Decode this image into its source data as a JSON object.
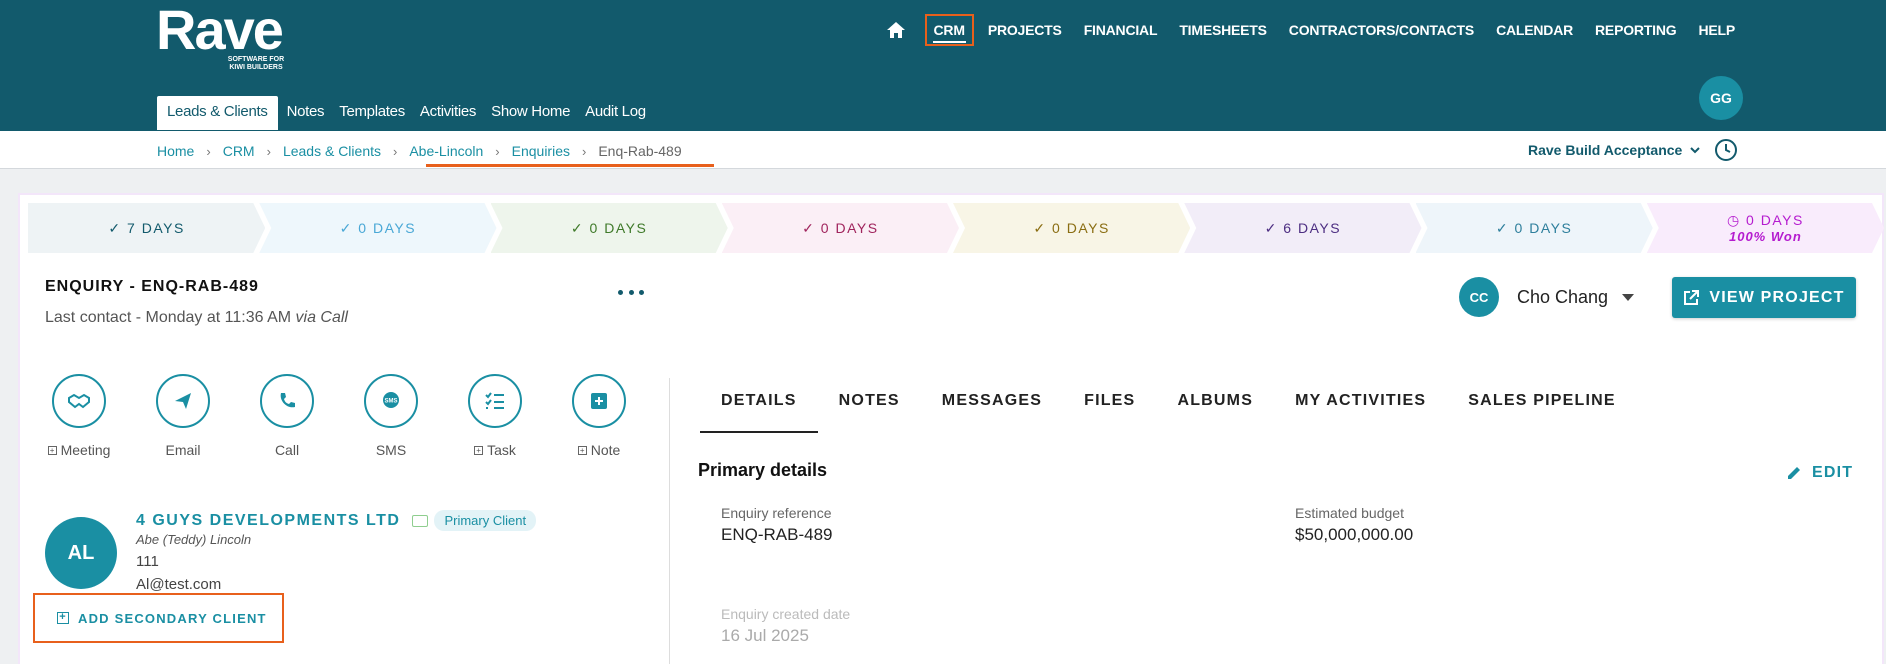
{
  "header": {
    "logo_word": "Rave",
    "logo_tagline": "SOFTWARE FOR KIWI BUILDERS",
    "nav": [
      "CRM",
      "PROJECTS",
      "FINANCIAL",
      "TIMESHEETS",
      "CONTRACTORS/CONTACTS",
      "CALENDAR",
      "REPORTING",
      "HELP"
    ],
    "user_initials": "GG",
    "subnav": [
      "Leads & Clients",
      "Notes",
      "Templates",
      "Activities",
      "Show Home",
      "Audit Log"
    ]
  },
  "breadcrumb": [
    "Home",
    "CRM",
    "Leads & Clients",
    "Abe-Lincoln",
    "Enquiries",
    "Enq-Rab-489"
  ],
  "build_selector": "Rave Build Acceptance",
  "stages": [
    {
      "label": "7 DAYS",
      "sub": ""
    },
    {
      "label": "0 DAYS",
      "sub": ""
    },
    {
      "label": "0 DAYS",
      "sub": ""
    },
    {
      "label": "0 DAYS",
      "sub": ""
    },
    {
      "label": "0 DAYS",
      "sub": ""
    },
    {
      "label": "6 DAYS",
      "sub": ""
    },
    {
      "label": "0 DAYS",
      "sub": ""
    },
    {
      "label": "0 DAYS",
      "sub": "100% Won"
    }
  ],
  "stage_colors": [
    {
      "bg": "#eef3f5",
      "fg": "#125a6c"
    },
    {
      "bg": "#eef7fc",
      "fg": "#4aa8d6"
    },
    {
      "bg": "#eef5ec",
      "fg": "#3f7a2a"
    },
    {
      "bg": "#fbeff6",
      "fg": "#a0245d"
    },
    {
      "bg": "#f8f5e6",
      "fg": "#8a6d12"
    },
    {
      "bg": "#f2edf8",
      "fg": "#4d2e82"
    },
    {
      "bg": "#eef5fa",
      "fg": "#2e7f9c"
    },
    {
      "bg": "#f9ecfc",
      "fg": "#b51ccf"
    }
  ],
  "enquiry": {
    "title": "ENQUIRY - ENQ-RAB-489",
    "last_contact": "Last contact - Monday at 11:36 AM",
    "via": "via Call"
  },
  "owner": {
    "initials": "CC",
    "name": "Cho Chang"
  },
  "view_project_label": "VIEW PROJECT",
  "actions": [
    {
      "label": "Meeting",
      "icon": "handshake-icon",
      "plus": true
    },
    {
      "label": "Email",
      "icon": "paper-plane-icon",
      "plus": false
    },
    {
      "label": "Call",
      "icon": "phone-icon",
      "plus": false
    },
    {
      "label": "SMS",
      "icon": "sms-icon",
      "plus": false
    },
    {
      "label": "Task",
      "icon": "checklist-icon",
      "plus": true
    },
    {
      "label": "Note",
      "icon": "add-note-icon",
      "plus": true
    }
  ],
  "client": {
    "initials": "AL",
    "company": "4 GUYS DEVELOPMENTS LTD",
    "badge": "Primary Client",
    "contact": "Abe (Teddy) Lincoln",
    "phone": "111",
    "email": "Al@test.com"
  },
  "add_secondary_label": "ADD SECONDARY CLIENT",
  "tabs": [
    "DETAILS",
    "NOTES",
    "MESSAGES",
    "FILES",
    "ALBUMS",
    "MY ACTIVITIES",
    "SALES PIPELINE"
  ],
  "primary_details": {
    "title": "Primary details",
    "edit_label": "EDIT",
    "enquiry_ref_label": "Enquiry reference",
    "enquiry_ref": "ENQ-RAB-489",
    "budget_label": "Estimated budget",
    "budget": "$50,000,000.00",
    "created_label": "Enquiry created date",
    "created": "16 Jul 2025"
  },
  "accent_color": "#1a8fa3",
  "header_color": "#125a6c",
  "highlight_color": "#e8601c"
}
